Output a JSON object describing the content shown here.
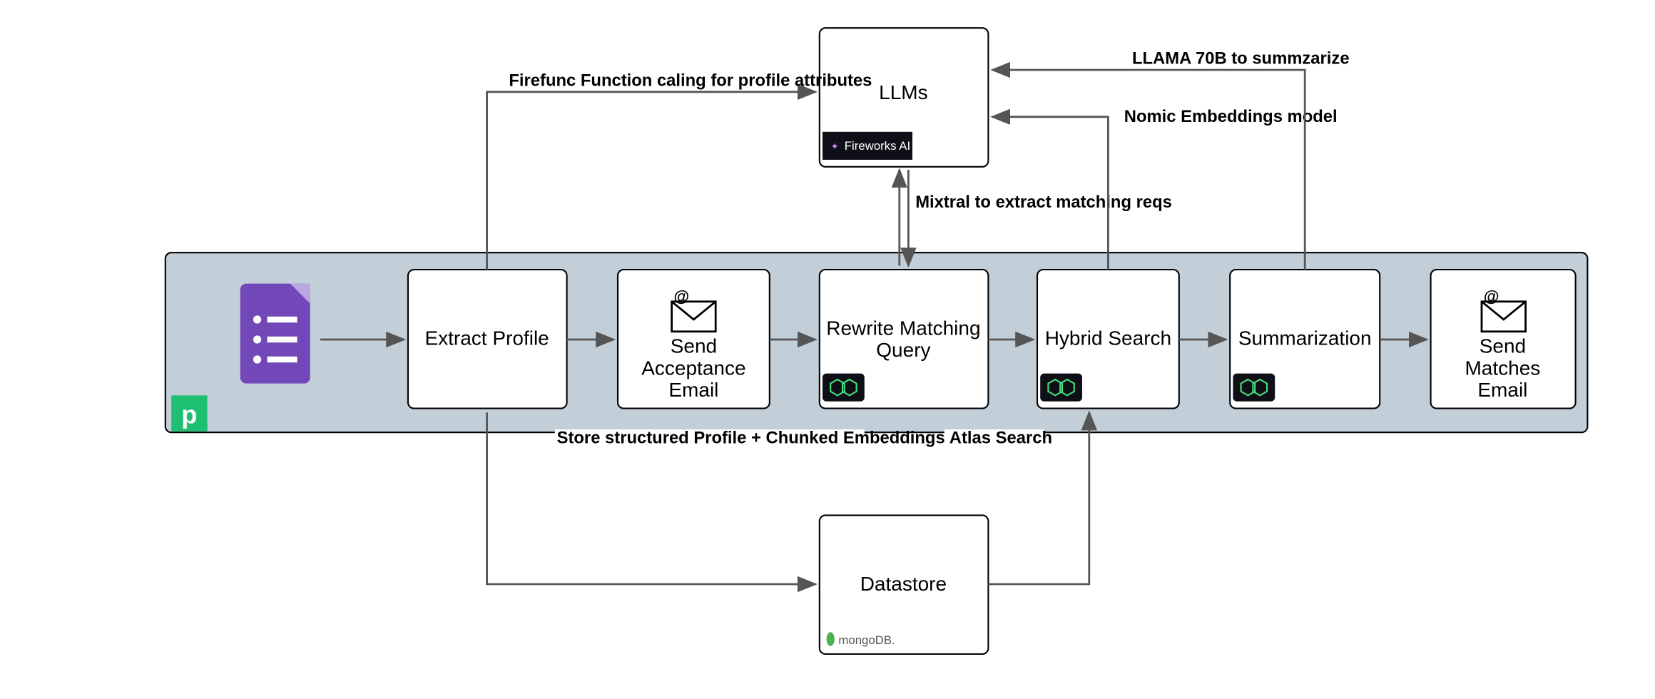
{
  "nodes": {
    "llms": {
      "label": "LLMs",
      "badge": "Fireworks AI"
    },
    "extract_profile": {
      "label": "Extract Profile"
    },
    "send_acceptance": {
      "line1": "Send",
      "line2": "Acceptance",
      "line3": "Email"
    },
    "rewrite_query": {
      "line1": "Rewrite Matching",
      "line2": "Query"
    },
    "hybrid_search": {
      "label": "Hybrid Search"
    },
    "summarization": {
      "label": "Summarization"
    },
    "send_matches": {
      "line1": "Send",
      "line2": "Matches",
      "line3": "Email"
    },
    "datastore": {
      "label": "Datastore",
      "badge": "mongoDB."
    }
  },
  "edges": {
    "firefunc": "Firefunc Function caling for profile attributes",
    "mixtral": "Mixtral to extract matching reqs",
    "nomic": "Nomic Embeddings model",
    "llama": "LLAMA 70B to summzarize",
    "store": "Store structured Profile + Chunked Embeddings",
    "atlas": "Atlas Search"
  },
  "platform_badge": "p"
}
